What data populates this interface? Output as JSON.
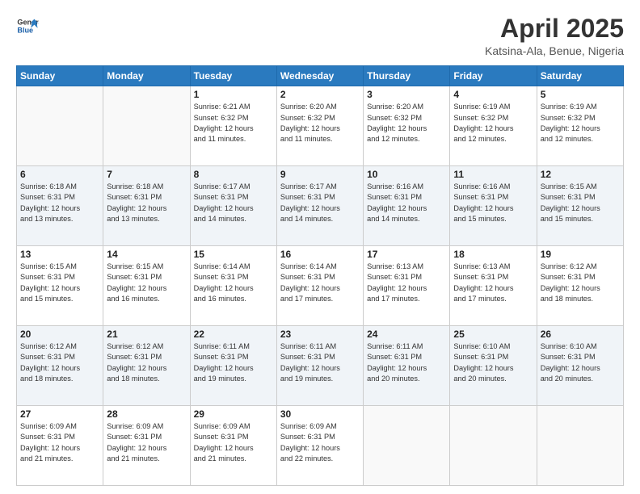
{
  "logo": {
    "line1": "General",
    "line2": "Blue"
  },
  "header": {
    "month": "April 2025",
    "location": "Katsina-Ala, Benue, Nigeria"
  },
  "weekdays": [
    "Sunday",
    "Monday",
    "Tuesday",
    "Wednesday",
    "Thursday",
    "Friday",
    "Saturday"
  ],
  "weeks": [
    [
      {
        "day": "",
        "info": ""
      },
      {
        "day": "",
        "info": ""
      },
      {
        "day": "1",
        "info": "Sunrise: 6:21 AM\nSunset: 6:32 PM\nDaylight: 12 hours\nand 11 minutes."
      },
      {
        "day": "2",
        "info": "Sunrise: 6:20 AM\nSunset: 6:32 PM\nDaylight: 12 hours\nand 11 minutes."
      },
      {
        "day": "3",
        "info": "Sunrise: 6:20 AM\nSunset: 6:32 PM\nDaylight: 12 hours\nand 12 minutes."
      },
      {
        "day": "4",
        "info": "Sunrise: 6:19 AM\nSunset: 6:32 PM\nDaylight: 12 hours\nand 12 minutes."
      },
      {
        "day": "5",
        "info": "Sunrise: 6:19 AM\nSunset: 6:32 PM\nDaylight: 12 hours\nand 12 minutes."
      }
    ],
    [
      {
        "day": "6",
        "info": "Sunrise: 6:18 AM\nSunset: 6:31 PM\nDaylight: 12 hours\nand 13 minutes."
      },
      {
        "day": "7",
        "info": "Sunrise: 6:18 AM\nSunset: 6:31 PM\nDaylight: 12 hours\nand 13 minutes."
      },
      {
        "day": "8",
        "info": "Sunrise: 6:17 AM\nSunset: 6:31 PM\nDaylight: 12 hours\nand 14 minutes."
      },
      {
        "day": "9",
        "info": "Sunrise: 6:17 AM\nSunset: 6:31 PM\nDaylight: 12 hours\nand 14 minutes."
      },
      {
        "day": "10",
        "info": "Sunrise: 6:16 AM\nSunset: 6:31 PM\nDaylight: 12 hours\nand 14 minutes."
      },
      {
        "day": "11",
        "info": "Sunrise: 6:16 AM\nSunset: 6:31 PM\nDaylight: 12 hours\nand 15 minutes."
      },
      {
        "day": "12",
        "info": "Sunrise: 6:15 AM\nSunset: 6:31 PM\nDaylight: 12 hours\nand 15 minutes."
      }
    ],
    [
      {
        "day": "13",
        "info": "Sunrise: 6:15 AM\nSunset: 6:31 PM\nDaylight: 12 hours\nand 15 minutes."
      },
      {
        "day": "14",
        "info": "Sunrise: 6:15 AM\nSunset: 6:31 PM\nDaylight: 12 hours\nand 16 minutes."
      },
      {
        "day": "15",
        "info": "Sunrise: 6:14 AM\nSunset: 6:31 PM\nDaylight: 12 hours\nand 16 minutes."
      },
      {
        "day": "16",
        "info": "Sunrise: 6:14 AM\nSunset: 6:31 PM\nDaylight: 12 hours\nand 17 minutes."
      },
      {
        "day": "17",
        "info": "Sunrise: 6:13 AM\nSunset: 6:31 PM\nDaylight: 12 hours\nand 17 minutes."
      },
      {
        "day": "18",
        "info": "Sunrise: 6:13 AM\nSunset: 6:31 PM\nDaylight: 12 hours\nand 17 minutes."
      },
      {
        "day": "19",
        "info": "Sunrise: 6:12 AM\nSunset: 6:31 PM\nDaylight: 12 hours\nand 18 minutes."
      }
    ],
    [
      {
        "day": "20",
        "info": "Sunrise: 6:12 AM\nSunset: 6:31 PM\nDaylight: 12 hours\nand 18 minutes."
      },
      {
        "day": "21",
        "info": "Sunrise: 6:12 AM\nSunset: 6:31 PM\nDaylight: 12 hours\nand 18 minutes."
      },
      {
        "day": "22",
        "info": "Sunrise: 6:11 AM\nSunset: 6:31 PM\nDaylight: 12 hours\nand 19 minutes."
      },
      {
        "day": "23",
        "info": "Sunrise: 6:11 AM\nSunset: 6:31 PM\nDaylight: 12 hours\nand 19 minutes."
      },
      {
        "day": "24",
        "info": "Sunrise: 6:11 AM\nSunset: 6:31 PM\nDaylight: 12 hours\nand 20 minutes."
      },
      {
        "day": "25",
        "info": "Sunrise: 6:10 AM\nSunset: 6:31 PM\nDaylight: 12 hours\nand 20 minutes."
      },
      {
        "day": "26",
        "info": "Sunrise: 6:10 AM\nSunset: 6:31 PM\nDaylight: 12 hours\nand 20 minutes."
      }
    ],
    [
      {
        "day": "27",
        "info": "Sunrise: 6:09 AM\nSunset: 6:31 PM\nDaylight: 12 hours\nand 21 minutes."
      },
      {
        "day": "28",
        "info": "Sunrise: 6:09 AM\nSunset: 6:31 PM\nDaylight: 12 hours\nand 21 minutes."
      },
      {
        "day": "29",
        "info": "Sunrise: 6:09 AM\nSunset: 6:31 PM\nDaylight: 12 hours\nand 21 minutes."
      },
      {
        "day": "30",
        "info": "Sunrise: 6:09 AM\nSunset: 6:31 PM\nDaylight: 12 hours\nand 22 minutes."
      },
      {
        "day": "",
        "info": ""
      },
      {
        "day": "",
        "info": ""
      },
      {
        "day": "",
        "info": ""
      }
    ]
  ]
}
